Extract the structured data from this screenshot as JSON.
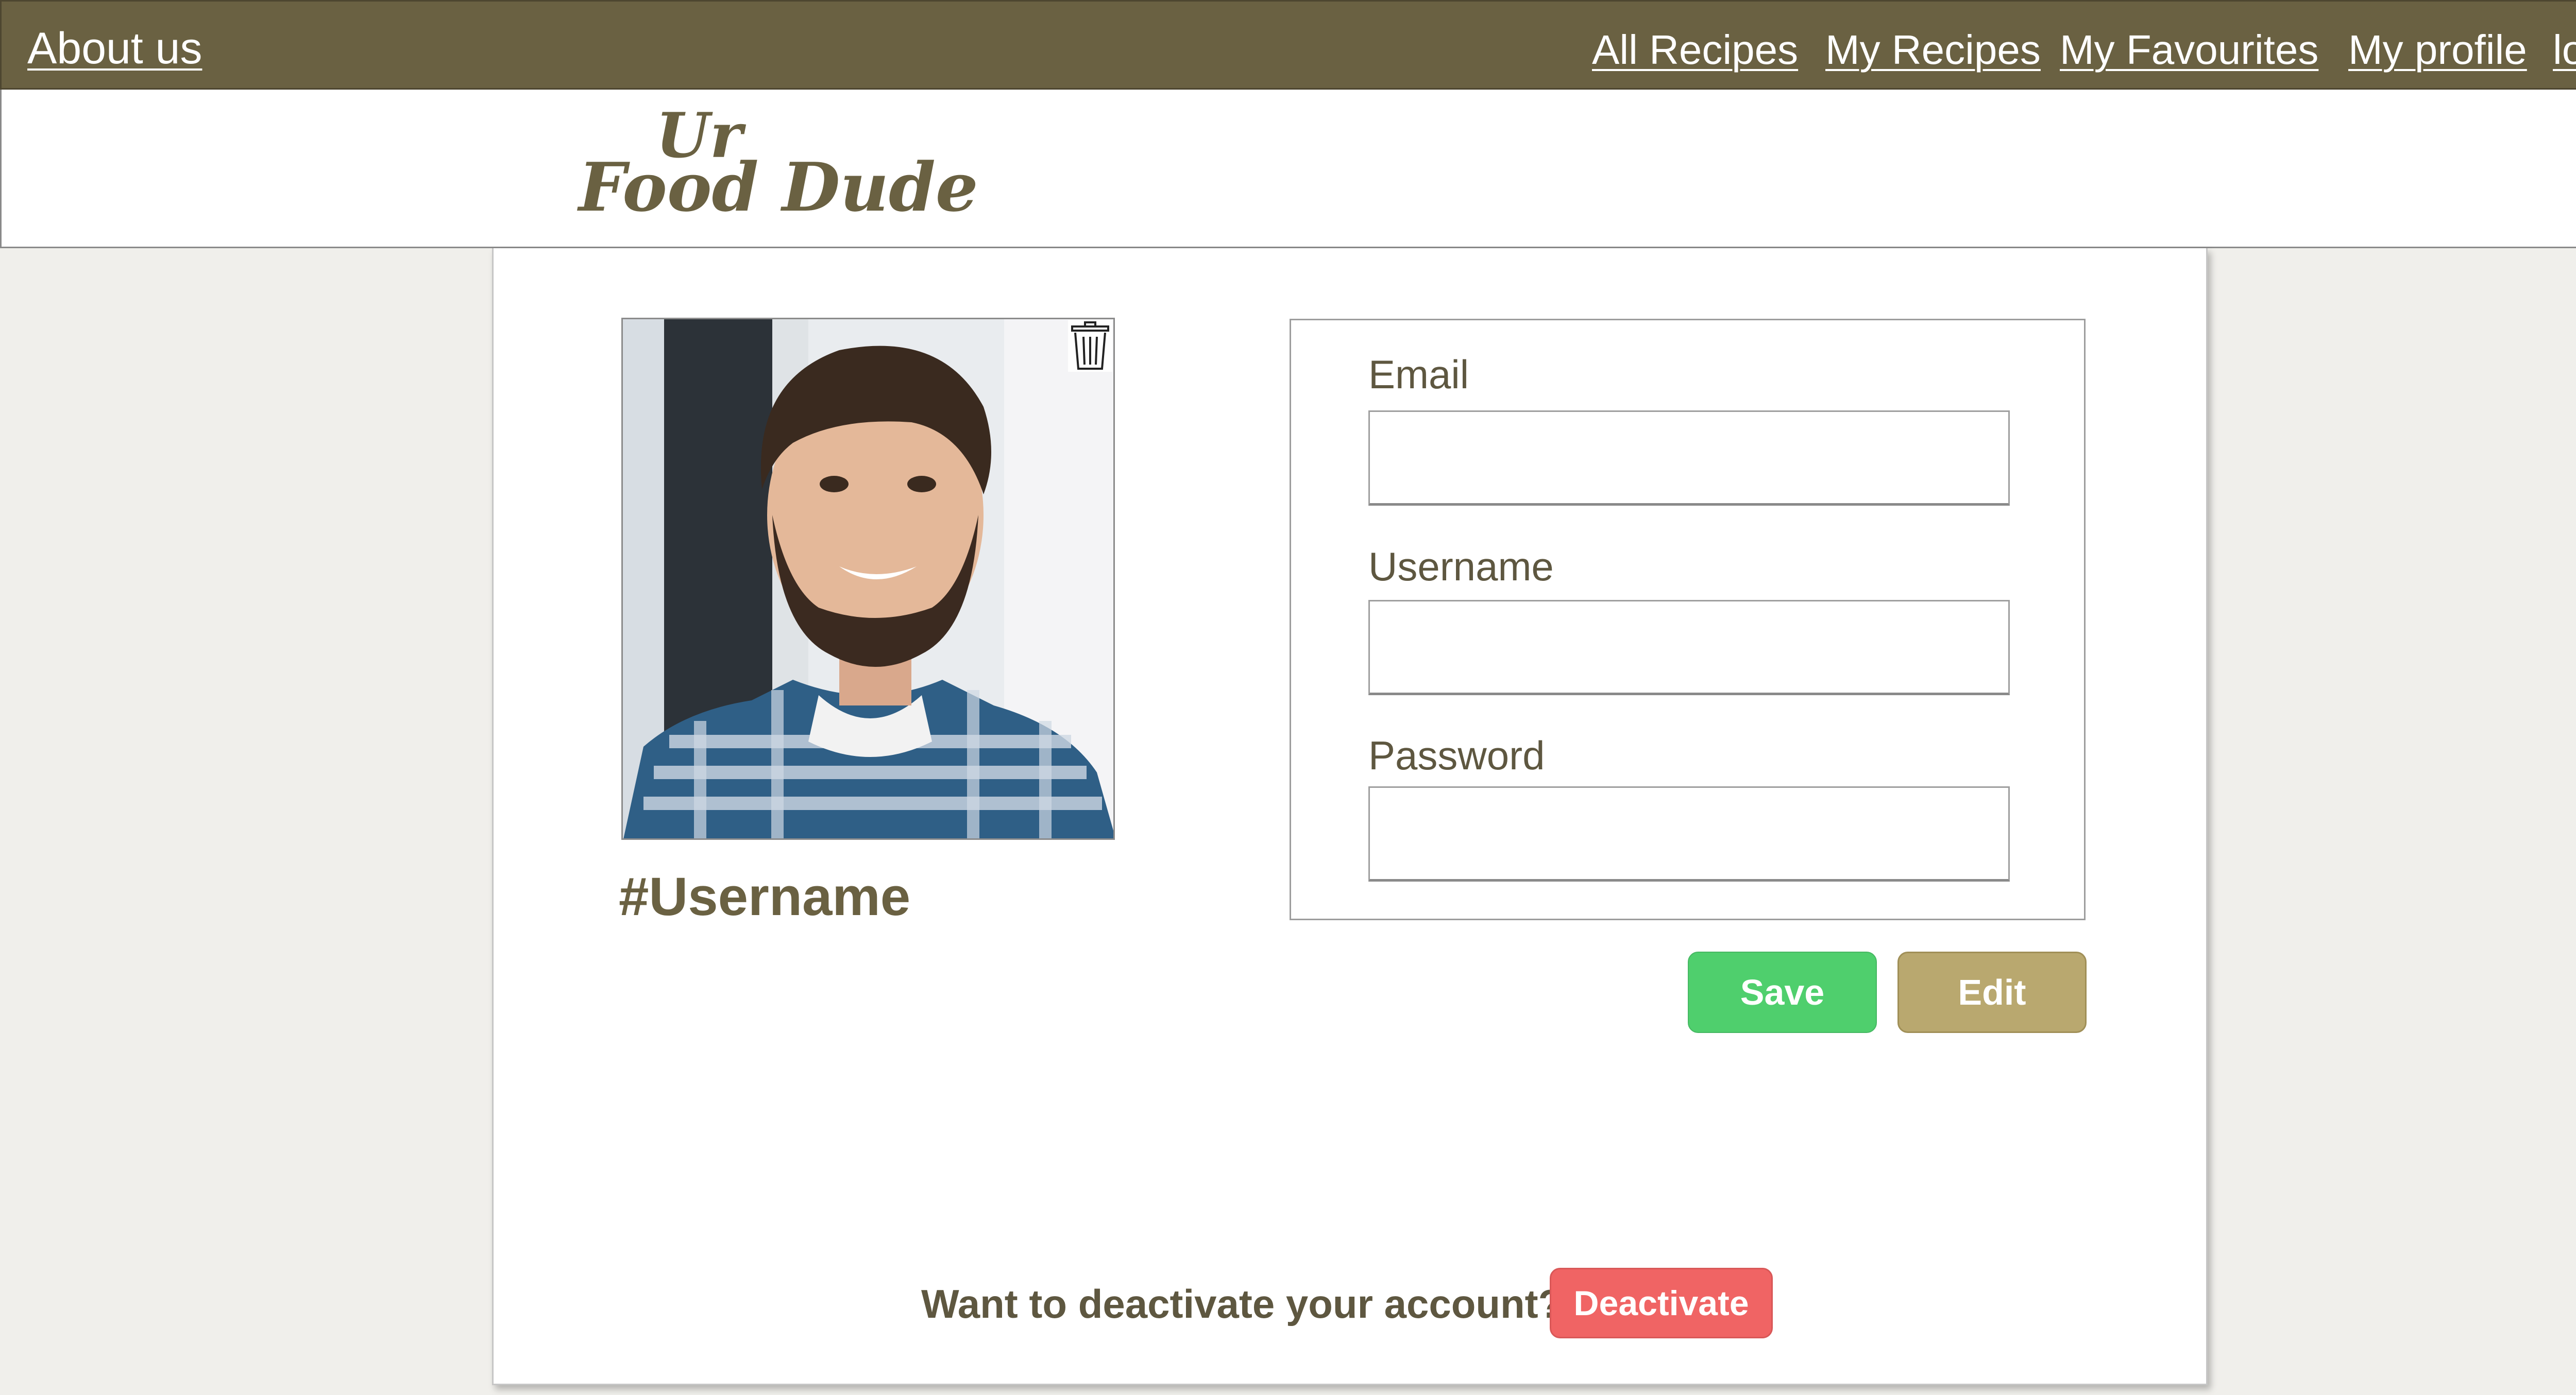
{
  "nav": {
    "about_label": "About us",
    "all_recipes_label": "All Recipes",
    "my_recipes_label": "My Recipes",
    "my_favourites_label": "My Favourites",
    "my_profile_label": "My profile",
    "logout_label": "log out"
  },
  "logo": {
    "line1": "Ur",
    "line2": "Food Dude"
  },
  "profile": {
    "username_display": "#Username",
    "photo_icon": "trash-icon"
  },
  "form": {
    "email_label": "Email",
    "email_value": "",
    "username_label": "Username",
    "username_value": "",
    "password_label": "Password",
    "password_value": ""
  },
  "actions": {
    "save_label": "Save",
    "edit_label": "Edit"
  },
  "deactivate": {
    "prompt": "Want to deactivate your account?",
    "button_label": "Deactivate"
  },
  "colors": {
    "nav_bg": "#6a6142",
    "brand": "#6a6142",
    "save": "#4fcf6d",
    "edit": "#b9a86f",
    "danger": "#f06464",
    "page_bg": "#f0efeb"
  }
}
